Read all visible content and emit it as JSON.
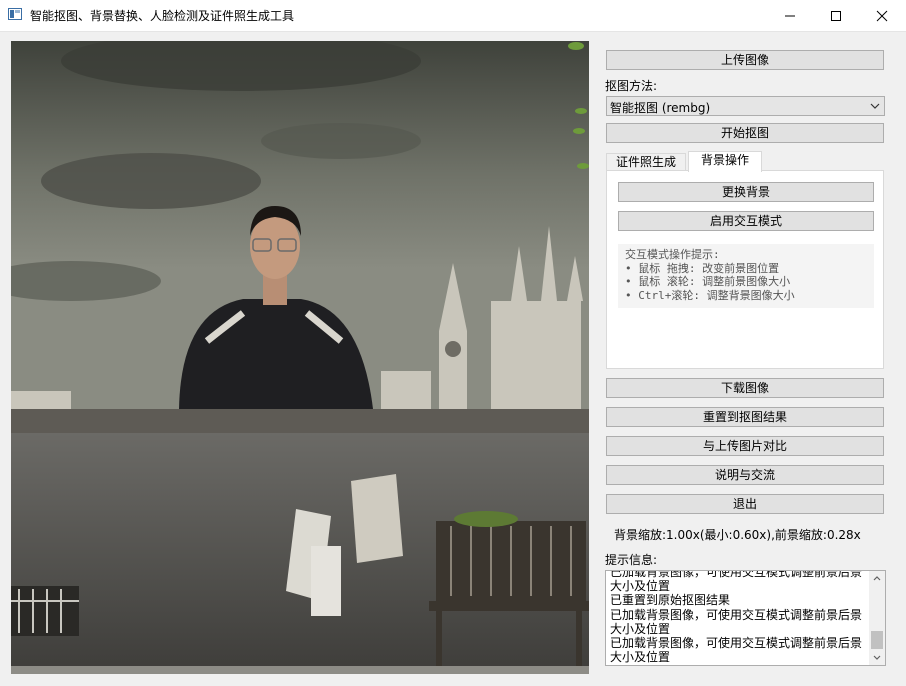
{
  "window": {
    "title": "智能抠图、背景替换、人脸检测及证件照生成工具"
  },
  "controls": {
    "upload_button": "上传图像",
    "method_label": "抠图方法:",
    "method_selected": "智能抠图 (rembg)",
    "start_button": "开始抠图",
    "tabs": [
      {
        "label": "证件照生成",
        "active": false
      },
      {
        "label": "背景操作",
        "active": true
      }
    ],
    "replace_bg_button": "更换背景",
    "interactive_mode_button": "启用交互模式",
    "hint_title": "交互模式操作提示:",
    "hint_lines": [
      "• 鼠标 拖拽: 改变前景图位置",
      "• 鼠标 滚轮: 调整前景图像大小",
      "• Ctrl+滚轮: 调整背景图像大小"
    ],
    "download_button": "下载图像",
    "reset_button": "重置到抠图结果",
    "compare_button": "与上传图片对比",
    "help_button": "说明与交流",
    "exit_button": "退出",
    "scale_status": "背景缩放:1.00x(最小:0.60x),前景缩放:0.28x",
    "info_label": "提示信息:",
    "log_lines": [
      "已加载背景图像，可使用交互模式调整前景后景大小及位置",
      "已重置到原始抠图结果",
      "已加载背景图像，可使用交互模式调整前景后景大小及位置",
      "已加载背景图像，可使用交互模式调整前景后景大小及位置"
    ]
  },
  "colors": {
    "button_bg": "#e1e1e1",
    "button_border": "#adadad",
    "window_bg": "#f0f0f0"
  }
}
